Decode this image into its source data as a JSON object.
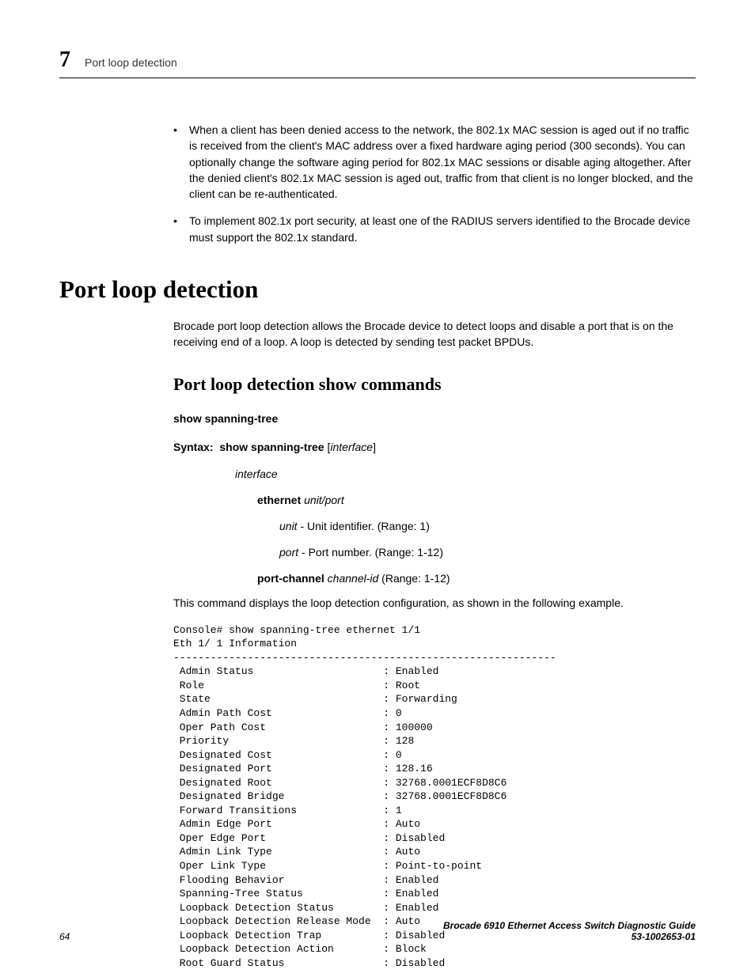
{
  "header": {
    "chapter_number": "7",
    "running_title": "Port loop detection"
  },
  "bullets": [
    "When a client has been denied access to the network, the 802.1x MAC session is aged out if no traffic is received from the client's MAC address over a fixed hardware aging period (300 seconds). You can optionally change the software aging period for 802.1x MAC sessions or disable aging altogether. After the denied client's 802.1x MAC session is aged out, traffic from that client is no longer blocked, and the client can be re-authenticated.",
    "To implement 802.1x port security, at least one of the RADIUS servers identified to the Brocade device must support the 802.1x standard."
  ],
  "section_title": "Port loop detection",
  "intro": "Brocade port loop detection allows the Brocade device to detect loops and disable a port that is on the receiving end of a loop. A loop is detected by sending test packet BPDUs.",
  "subsection_title": "Port loop detection show commands",
  "command": {
    "name": "show spanning-tree",
    "syntax_label": "Syntax:",
    "syntax_cmd": "show spanning-tree",
    "syntax_arg": "interface",
    "param_interface": "interface",
    "param_ethernet_kw": "ethernet",
    "param_ethernet_arg": "unit/port",
    "param_unit_label": "unit",
    "param_unit_desc": " - Unit identifier. (Range: 1)",
    "param_port_label": "port",
    "param_port_desc": " - Port number. (Range: 1-12)",
    "param_portchannel_kw": "port-channel",
    "param_portchannel_arg": "channel-id",
    "param_portchannel_desc": " (Range: 1-12)",
    "description": "This command displays the loop detection configuration, as shown in the following example."
  },
  "console": "Console# show spanning-tree ethernet 1/1\nEth 1/ 1 Information\n--------------------------------------------------------------\n Admin Status                     : Enabled\n Role                             : Root\n State                            : Forwarding\n Admin Path Cost                  : 0\n Oper Path Cost                   : 100000\n Priority                         : 128\n Designated Cost                  : 0\n Designated Port                  : 128.16\n Designated Root                  : 32768.0001ECF8D8C6\n Designated Bridge                : 32768.0001ECF8D8C6\n Forward Transitions              : 1\n Admin Edge Port                  : Auto\n Oper Edge Port                   : Disabled\n Admin Link Type                  : Auto\n Oper Link Type                   : Point-to-point\n Flooding Behavior                : Enabled\n Spanning-Tree Status             : Enabled\n Loopback Detection Status        : Enabled\n Loopback Detection Release Mode  : Auto\n Loopback Detection Trap          : Disabled\n Loopback Detection Action        : Block\n Root Guard Status                : Disabled",
  "footer": {
    "page_number": "64",
    "doc_title": "Brocade 6910 Ethernet Access Switch Diagnostic Guide",
    "doc_id": "53-1002653-01"
  }
}
